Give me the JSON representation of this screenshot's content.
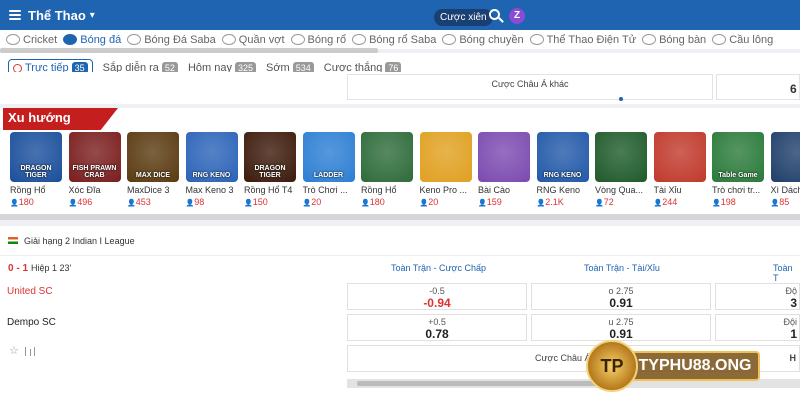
{
  "header": {
    "title": "Thể Thao",
    "combo_label": "Cược xiên",
    "logo_letter": "Z"
  },
  "sports": [
    {
      "label": "Cricket",
      "icon": "cricket-icon",
      "active": false
    },
    {
      "label": "Bóng đá",
      "icon": "soccer-ball-icon",
      "active": true
    },
    {
      "label": "Bóng Đá Saba",
      "icon": "soccer-ball-icon",
      "active": false
    },
    {
      "label": "Quần vợt",
      "icon": "tennis-icon",
      "active": false
    },
    {
      "label": "Bóng rổ",
      "icon": "basketball-icon",
      "active": false
    },
    {
      "label": "Bóng rổ Saba",
      "icon": "basketball-icon",
      "active": false
    },
    {
      "label": "Bóng chuyền",
      "icon": "volleyball-icon",
      "active": false
    },
    {
      "label": "Thể Thao Điện Tử",
      "icon": "esports-icon",
      "active": false
    },
    {
      "label": "Bóng bàn",
      "icon": "table-tennis-icon",
      "active": false
    },
    {
      "label": "Cầu lông",
      "icon": "badminton-icon",
      "active": false
    }
  ],
  "filters": [
    {
      "label": "Trực tiếp",
      "count": "35",
      "active": true
    },
    {
      "label": "Sắp diễn ra",
      "count": "52",
      "active": false
    },
    {
      "label": "Hôm nay",
      "count": "325",
      "active": false
    },
    {
      "label": "Sớm",
      "count": "534",
      "active": false
    },
    {
      "label": "Cược thắng",
      "count": "76",
      "active": false
    }
  ],
  "prev_row": {
    "more_label": "Cược Châu Á khác",
    "right_value": "6"
  },
  "trending": {
    "title": "Xu hướng",
    "games": [
      {
        "name": "Rồng Hổ",
        "count": "180",
        "color": "#1a4f9c",
        "thumb": "DRAGON TIGER"
      },
      {
        "name": "Xóc Đĩa",
        "count": "496",
        "color": "#7a1d1d",
        "thumb": "FISH PRAWN CRAB"
      },
      {
        "name": "MaxDice 3",
        "count": "453",
        "color": "#5a3a10",
        "thumb": "MAX DICE"
      },
      {
        "name": "Max Keno 3",
        "count": "98",
        "color": "#2b63b8",
        "thumb": "RNG KENO"
      },
      {
        "name": "Rồng Hổ T4",
        "count": "150",
        "color": "#3c1a0a",
        "thumb": "DRAGON TIGER"
      },
      {
        "name": "Trò Chơi ...",
        "count": "20",
        "color": "#2c7fd3",
        "thumb": "LADDER"
      },
      {
        "name": "Rồng Hổ",
        "count": "180",
        "color": "#2e6b3a",
        "thumb": ""
      },
      {
        "name": "Keno Pro ...",
        "count": "20",
        "color": "#e0a020",
        "thumb": ""
      },
      {
        "name": "Bài Cào",
        "count": "159",
        "color": "#7b4ab0",
        "thumb": ""
      },
      {
        "name": "RNG Keno",
        "count": "2.1K",
        "color": "#2259a8",
        "thumb": "RNG KENO"
      },
      {
        "name": "Vòng Qua...",
        "count": "72",
        "color": "#1e5a2a",
        "thumb": ""
      },
      {
        "name": "Tài Xỉu",
        "count": "244",
        "color": "#c0392b",
        "thumb": ""
      },
      {
        "name": "Trò chơi tr...",
        "count": "198",
        "color": "#2a7a3a",
        "thumb": "Table Game"
      },
      {
        "name": "Xì Dách",
        "count": "85",
        "color": "#1f3f6a",
        "thumb": ""
      }
    ]
  },
  "league": {
    "name": "Giải hạng 2 Indian I League",
    "score": "0 - 1",
    "period": "Hiệp 1 23'",
    "columns": [
      "Toàn Trận - Cược Chấp",
      "Toàn Trận - Tài/Xỉu",
      "Toàn T"
    ],
    "home_team": "United SC",
    "away_team": "Dempo SC",
    "odds": {
      "home_hdp_line": "-0.5",
      "home_hdp_val": "-0.94",
      "home_ou_line": "o 2.75",
      "home_ou_val": "0.91",
      "home_x_line": "Độ",
      "home_x_val": "3",
      "away_hdp_line": "+0.5",
      "away_hdp_val": "0.78",
      "away_ou_line": "u 2.75",
      "away_ou_val": "0.91",
      "away_x_line": "Đội",
      "away_x_val": "1",
      "more_label": "Cược Châu Á khác",
      "more_right": "H"
    }
  },
  "watermark": {
    "text": "TYPHU88.ONG",
    "logo": "TP"
  }
}
